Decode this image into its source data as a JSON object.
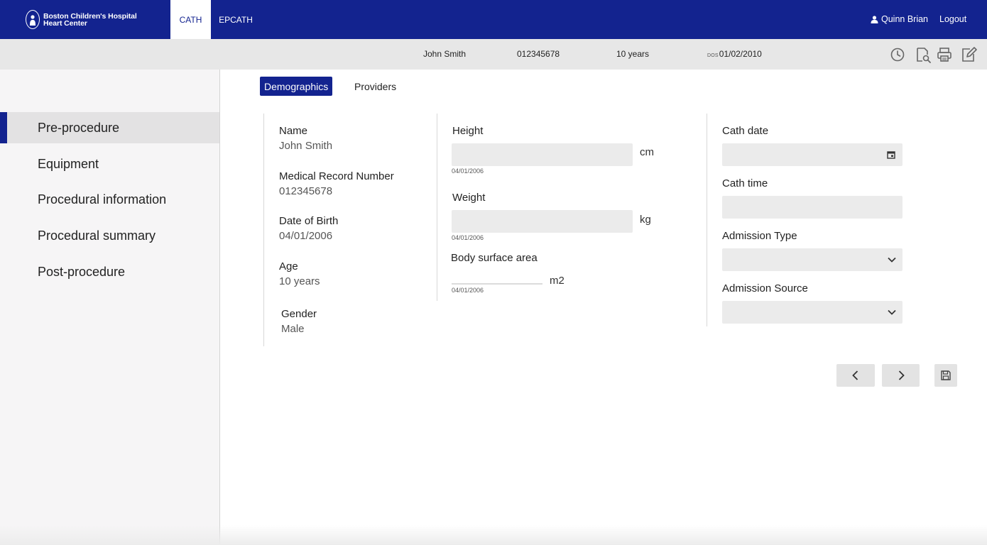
{
  "header": {
    "logo_line1": "Boston Children's Hospital",
    "logo_line2": "Heart Center",
    "tabs": [
      {
        "label": "CATH",
        "active": true
      },
      {
        "label": "EPCATH",
        "active": false
      }
    ],
    "user_name": "Quinn Brian",
    "logout_label": "Logout"
  },
  "patient_bar": {
    "name": "John Smith",
    "mrn": "012345678",
    "age": "10 years",
    "dos_label": "DOS",
    "dos_value": "01/02/2010",
    "tools": [
      "history-icon",
      "search-document-icon",
      "print-icon",
      "edit-icon"
    ]
  },
  "sidebar": {
    "items": [
      {
        "label": "Pre-procedure",
        "active": true
      },
      {
        "label": "Equipment",
        "active": false
      },
      {
        "label": "Procedural information",
        "active": false
      },
      {
        "label": "Procedural summary",
        "active": false
      },
      {
        "label": "Post-procedure",
        "active": false
      }
    ]
  },
  "subtabs": [
    {
      "label": "Demographics",
      "active": true
    },
    {
      "label": "Providers",
      "active": false
    }
  ],
  "demographics": {
    "name_label": "Name",
    "name_value": "John Smith",
    "mrn_label": "Medical Record Number",
    "mrn_value": "012345678",
    "dob_label": "Date of Birth",
    "dob_value": "04/01/2006",
    "age_label": "Age",
    "age_value": "10 years",
    "gender_label": "Gender",
    "gender_value": "Male"
  },
  "measurements": {
    "height_label": "Height",
    "height_value": "",
    "height_unit": "cm",
    "height_date": "04/01/2006",
    "weight_label": "Weight",
    "weight_value": "",
    "weight_unit": "kg",
    "weight_date": "04/01/2006",
    "bsa_label": "Body surface area",
    "bsa_value": "",
    "bsa_unit": "m2",
    "bsa_date": "04/01/2006"
  },
  "cath": {
    "cath_date_label": "Cath date",
    "cath_date_value": "",
    "cath_time_label": "Cath time",
    "cath_time_value": "",
    "admission_type_label": "Admission Type",
    "admission_type_value": "",
    "admission_source_label": "Admission Source",
    "admission_source_value": ""
  },
  "actions": [
    "chevron-left-icon",
    "chevron-right-icon",
    "save-icon"
  ],
  "colors": {
    "brand": "#13238f",
    "field_bg": "#ebebeb",
    "sidebar_bg": "#f6f5f6"
  }
}
